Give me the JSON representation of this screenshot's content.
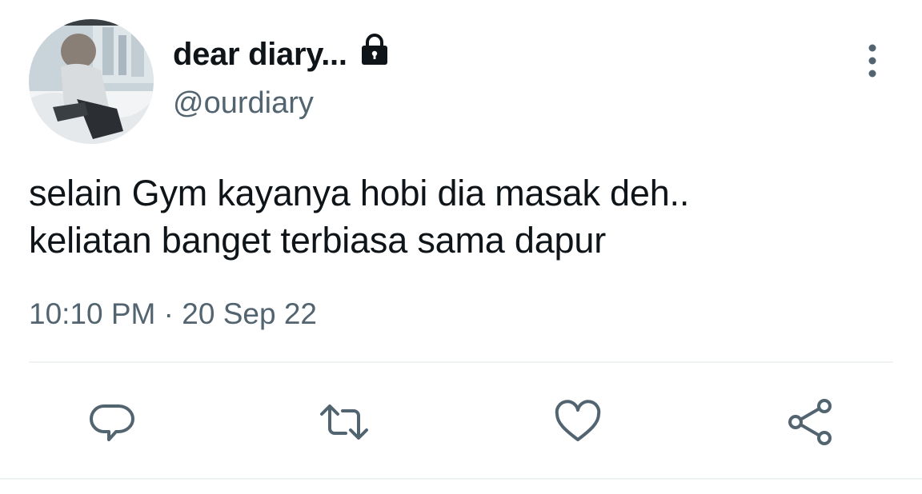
{
  "user": {
    "display_name": "dear diary...",
    "handle": "@ourdiary",
    "protected": true
  },
  "tweet": {
    "text_lines": [
      "selain Gym kayanya hobi dia masak deh..",
      "keliatan banget terbiasa sama dapur"
    ],
    "time": "10:10 PM",
    "separator": "·",
    "date": "20 Sep 22"
  },
  "icons": {
    "avatar": "avatar-photo",
    "lock": "lock-icon",
    "more": "more-vertical-icon",
    "reply": "reply-icon",
    "retweet": "retweet-icon",
    "like": "heart-icon",
    "share": "share-icon"
  },
  "colors": {
    "text_primary": "#0f1419",
    "text_secondary": "#536471",
    "divider": "#eff3f4"
  }
}
